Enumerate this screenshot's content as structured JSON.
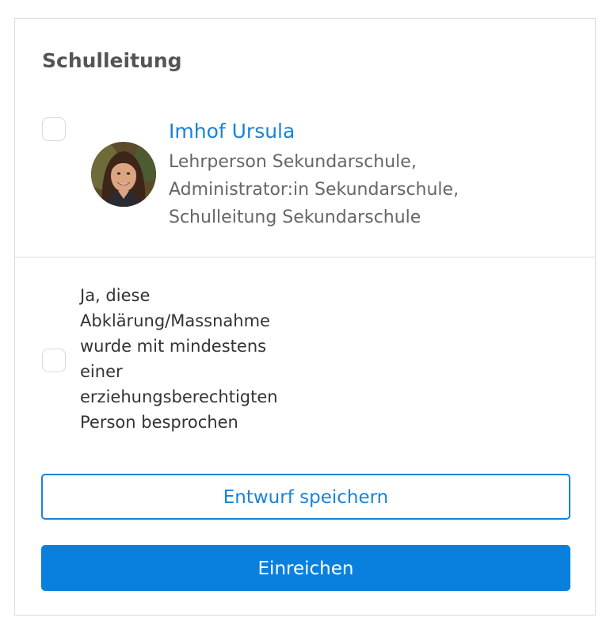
{
  "section": {
    "title": "Schulleitung"
  },
  "person": {
    "name": "Imhof Ursula",
    "roles": "Lehrperson Sekundarschule, Administrator:in Sekundarschule, Schulleitung Sekundarschule",
    "avatar": "profile-photo"
  },
  "confirmation": {
    "text": "Ja, diese Abklärung/Massnahme wurde mit mindestens einer erziehungsberechtigten Person besprochen",
    "checked": false
  },
  "buttons": {
    "draft_label": "Entwurf speichern",
    "submit_label": "Einreichen"
  },
  "colors": {
    "accent": "#1a82d8",
    "primary_button": "#0a80de",
    "title": "#555555",
    "border": "#dadde2"
  }
}
